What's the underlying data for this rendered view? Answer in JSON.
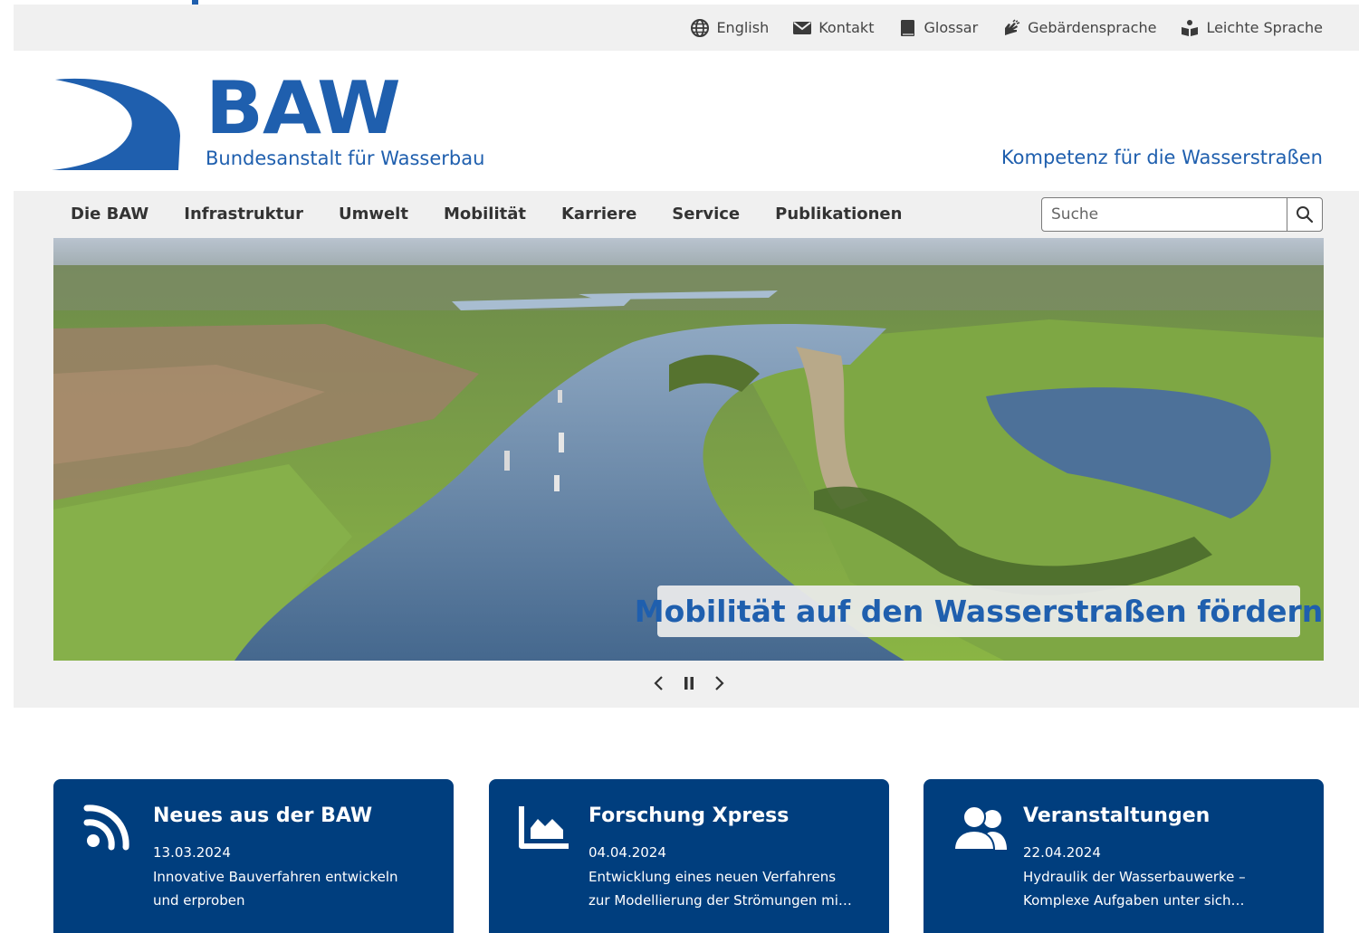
{
  "service_links": [
    {
      "label": "English",
      "icon": "globe-icon"
    },
    {
      "label": "Kontakt",
      "icon": "envelope-icon"
    },
    {
      "label": "Glossar",
      "icon": "book-icon"
    },
    {
      "label": "Gebärdensprache",
      "icon": "sign-language-icon"
    },
    {
      "label": "Leichte Sprache",
      "icon": "easy-language-icon"
    }
  ],
  "logo": {
    "title": "BAW",
    "subtitle": "Bundesanstalt für Wasserbau"
  },
  "tagline": "Kompetenz für die Wasserstraßen",
  "nav": [
    "Die BAW",
    "Infrastruktur",
    "Umwelt",
    "Mobilität",
    "Karriere",
    "Service",
    "Publikationen"
  ],
  "search": {
    "placeholder": "Suche"
  },
  "hero": {
    "caption": "Mobilität auf den Wasserstraßen fördern"
  },
  "cards": [
    {
      "title": "Neues aus der BAW",
      "date": "13.03.2024",
      "text": "Innovative Bauverfahren entwickeln und erproben",
      "icon": "rss-icon"
    },
    {
      "title": "Forschung Xpress",
      "date": "04.04.2024",
      "text": "Entwicklung eines neuen Verfahrens zur Modellierung der Strömungen mi…",
      "icon": "area-chart-icon"
    },
    {
      "title": "Veranstaltungen",
      "date": "22.04.2024",
      "text": "Hydraulik der Wasserbauwerke – Komplexe Aufgaben unter sich…",
      "icon": "users-icon"
    }
  ],
  "colors": {
    "brand": "#1f5fae",
    "card_bg": "#003e7e",
    "band_bg": "#f0f0f0"
  }
}
